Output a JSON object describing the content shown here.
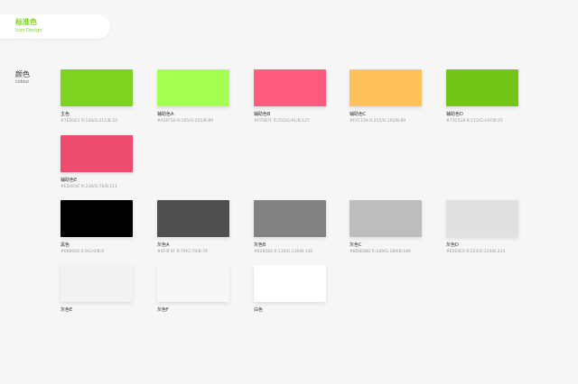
{
  "header": {
    "title": "标准色",
    "subtitle": "Icon Design",
    "accent_color": "#7ED321"
  },
  "section": {
    "title": "颜色",
    "subtitle": "colour"
  },
  "swatches": [
    {
      "name": "主色",
      "hex": "#7ED321",
      "meta": "#7ED321  R:126/G:211/B:33",
      "color": "#7ED321"
    },
    {
      "name": "辅助色A",
      "hex": "#A5FF50",
      "meta": "#A5FF50  R:165/G:255/B:80",
      "color": "#A5FF50"
    },
    {
      "name": "辅助色B",
      "hex": "#FF5B7F",
      "meta": "#FF5B7F  R:255/G:91/B:127",
      "color": "#FF5B7F"
    },
    {
      "name": "辅助色C",
      "hex": "#FFC159",
      "meta": "#FFC159  R:255/G:192/B:89",
      "color": "#FFC159"
    },
    {
      "name": "辅助色D",
      "hex": "#73C518",
      "meta": "#73C518  R:115/G:197/B:25",
      "color": "#73C518"
    },
    {
      "name": "辅助色E",
      "hex": "#ED4C6F",
      "meta": "#ED4C6F  R:236/G:76/B:111",
      "color": "#ED4C6F"
    },
    {
      "name": "黑色",
      "hex": "#000000",
      "meta": "#000000  R:0/G:0/B:0",
      "color": "#000000"
    },
    {
      "name": "灰色A",
      "hex": "#4F4F4F",
      "meta": "#4F4F4F  R:79/G:79/B:79",
      "color": "#4F4F4F"
    },
    {
      "name": "灰色B",
      "hex": "#828282",
      "meta": "#828282  R:130/G:130/B:130",
      "color": "#828282"
    },
    {
      "name": "灰色C",
      "hex": "#BDBDBD",
      "meta": "#BDBDBD  R:189/G:189/B:189",
      "color": "#BDBDBD"
    },
    {
      "name": "灰色D",
      "hex": "#E0E0E0",
      "meta": "#E0E0E0  R:224/G:224/B:224",
      "color": "#E0E0E0"
    },
    {
      "name": "灰色E",
      "hex": "",
      "meta": "",
      "color": "#F2F2F2"
    },
    {
      "name": "灰色F",
      "hex": "",
      "meta": "",
      "color": "#F7F7F7"
    },
    {
      "name": "白色",
      "hex": "",
      "meta": "",
      "color": "#FFFFFF"
    }
  ]
}
